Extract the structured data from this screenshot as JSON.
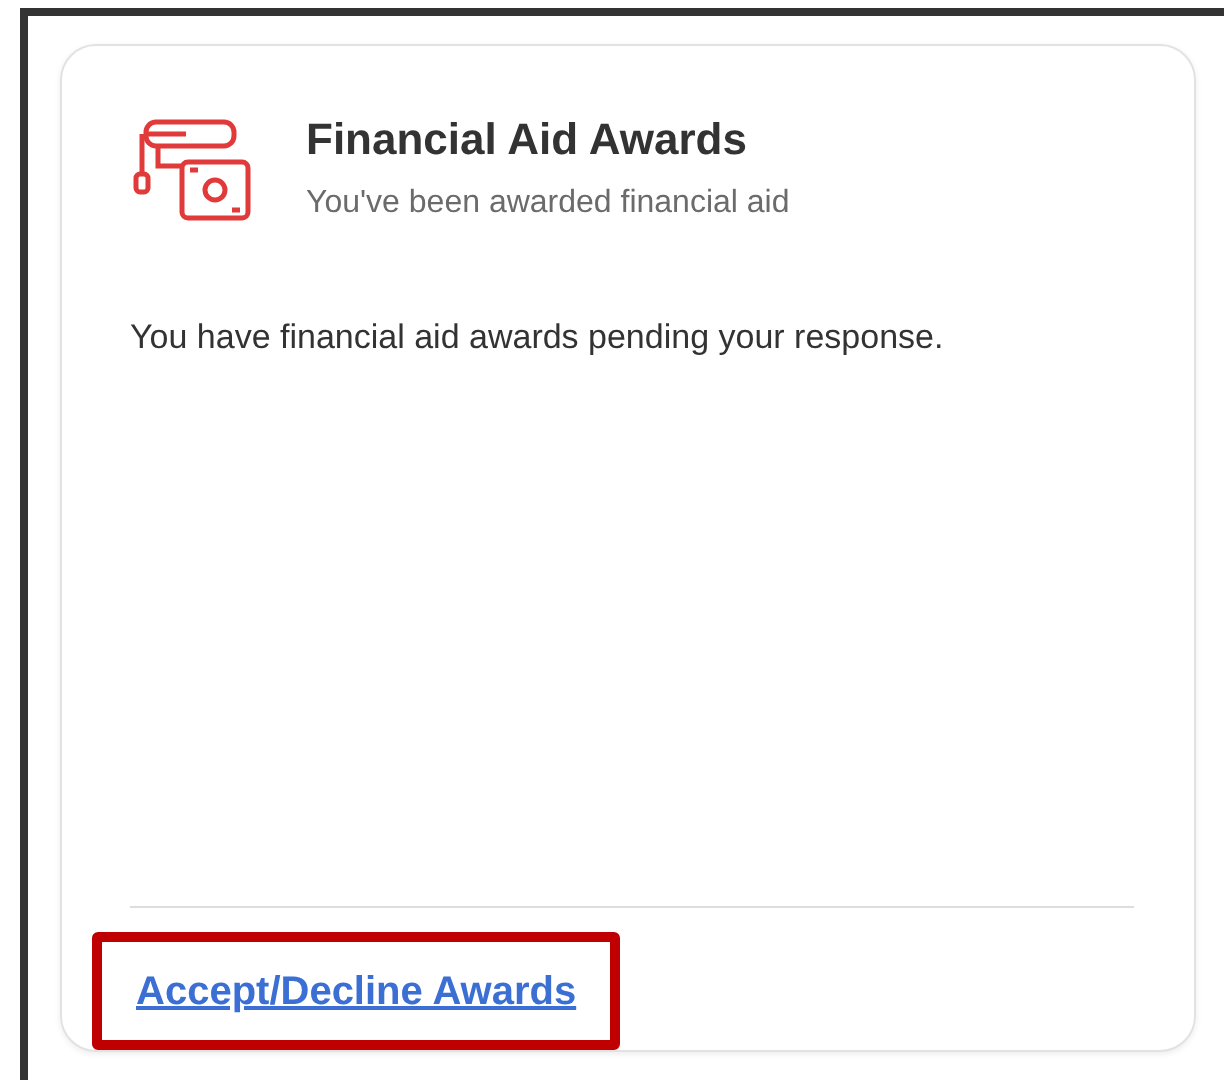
{
  "card": {
    "title": "Financial Aid Awards",
    "subtitle": "You've been awarded financial aid",
    "message": "You have financial aid awards pending your response.",
    "link": {
      "label": "Accept/Decline Awards",
      "highlighted": true
    }
  }
}
